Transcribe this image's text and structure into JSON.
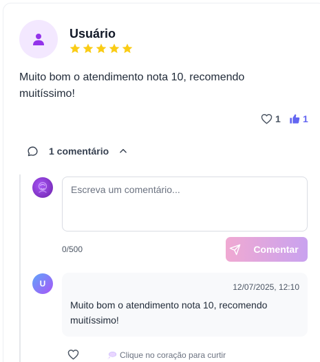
{
  "review": {
    "user_name": "Usuário",
    "rating": 5,
    "text": "Muito bom o atendimento nota 10, recomendo muitíssimo!",
    "like_count": "1",
    "thumb_count": "1"
  },
  "comments": {
    "toggle_label": "1 comentário",
    "input_placeholder": "Escreva um comentário...",
    "char_count": "0/500",
    "submit_label": "Comentar",
    "items": [
      {
        "avatar_letter": "U",
        "date": "12/07/2025, 12:10",
        "text": "Muito bom o atendimento nota 10, recomendo muitíssimo!",
        "hint": "Clique no coração para curtir"
      }
    ]
  },
  "colors": {
    "accent": "#9333ea",
    "star": "#facc15",
    "thumb": "#6366f1"
  }
}
